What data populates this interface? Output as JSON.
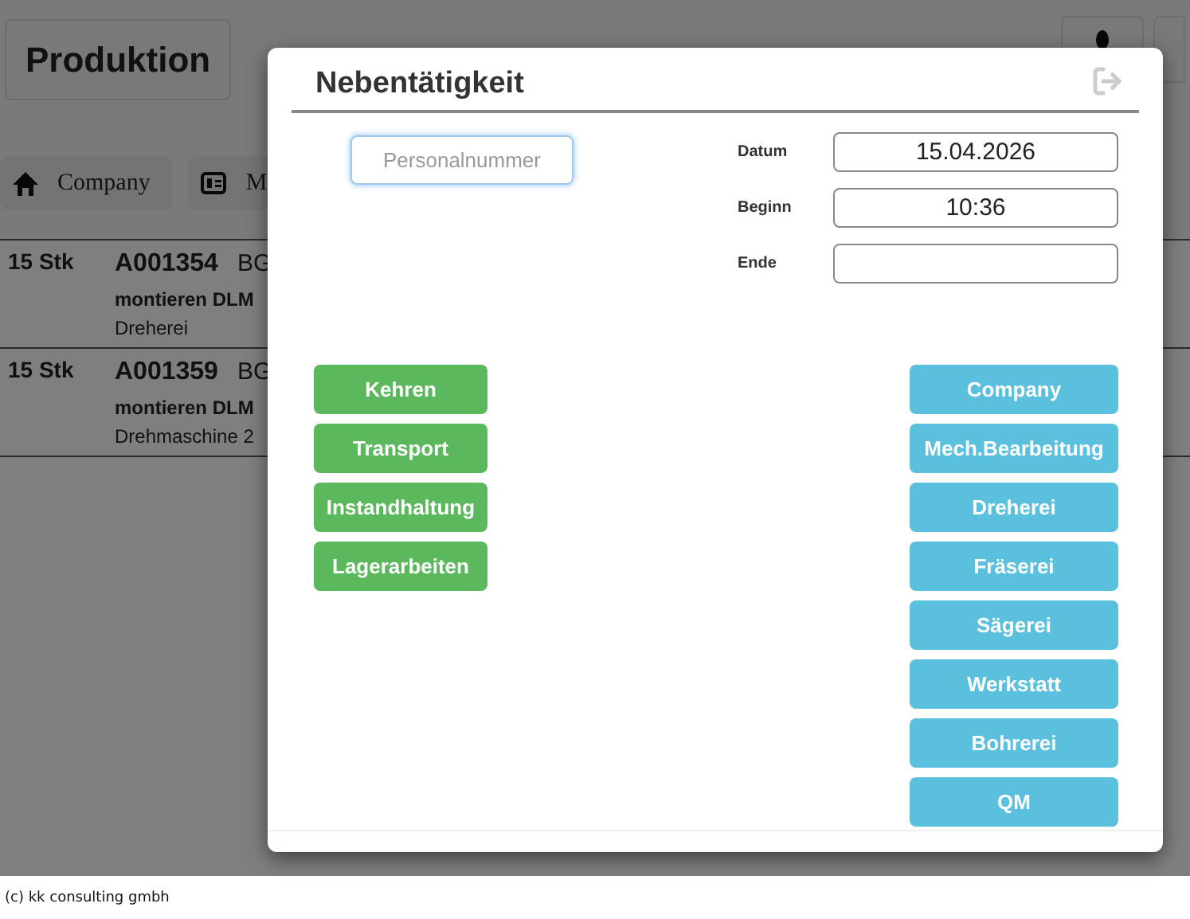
{
  "page": {
    "title": "Produktion",
    "toolbar": [
      {
        "label": "Company",
        "kind": "home"
      },
      {
        "label": "M",
        "kind": "machine"
      }
    ],
    "orders": [
      {
        "quantity": "15 Stk",
        "number": "A001354",
        "code": "BG",
        "operation": "montieren DLM",
        "place": "Dreherei"
      },
      {
        "quantity": "15 Stk",
        "number": "A001359",
        "code": "BG",
        "operation": "montieren DLM",
        "place": "Drehmaschine 2"
      }
    ]
  },
  "dialog": {
    "title": "Nebentätigkeit",
    "personal_number": {
      "placeholder": "Personalnummer"
    },
    "fields": [
      {
        "label": "Datum",
        "value": "15.04.2026"
      },
      {
        "label": "Beginn",
        "value": "10:36"
      },
      {
        "label": "Ende"
      }
    ],
    "activities": [
      "Kehren",
      "Transport",
      "Instandhaltung",
      "Lagerarbeiten"
    ],
    "departments": [
      "Company",
      "Mech.Bearbeitung",
      "Dreherei",
      "Fräserei",
      "Sägerei",
      "Werkstatt",
      "Bohrerei",
      "QM"
    ]
  },
  "footer": "(c) kk consulting gmbh"
}
